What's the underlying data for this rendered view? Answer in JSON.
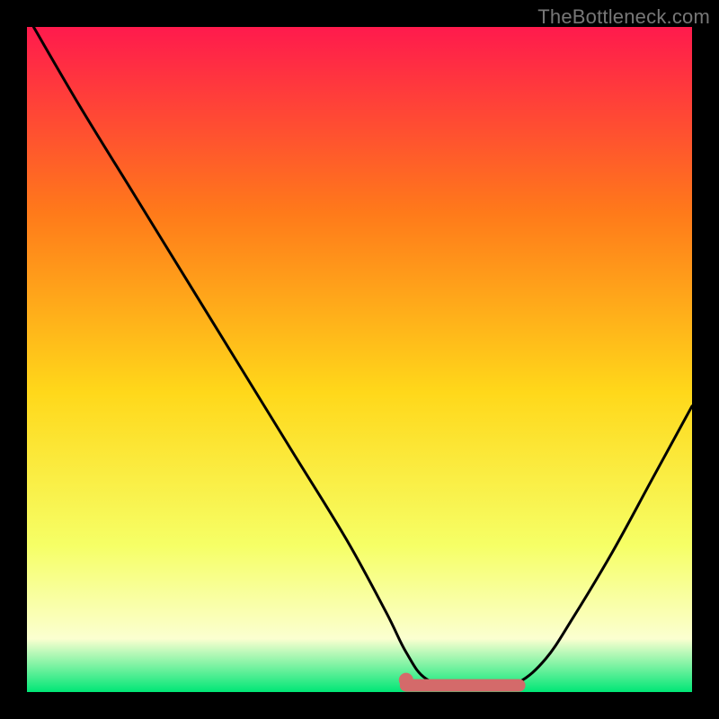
{
  "watermark": "TheBottleneck.com",
  "colors": {
    "background": "#000000",
    "grad_top": "#ff1a4d",
    "grad_upper_mid": "#ff7a1a",
    "grad_mid": "#ffd81a",
    "grad_lower_mid": "#f6ff66",
    "grad_pale": "#fbffd0",
    "grad_bottom": "#00e676",
    "curve": "#000000",
    "highlight": "#d46a6a"
  },
  "chart_data": {
    "type": "line",
    "title": "",
    "xlabel": "",
    "ylabel": "",
    "xlim": [
      0,
      100
    ],
    "ylim": [
      0,
      100
    ],
    "grid": false,
    "legend": false,
    "series": [
      {
        "name": "bottleneck-curve",
        "x": [
          1,
          8,
          16,
          24,
          32,
          40,
          48,
          54,
          57,
          60,
          65,
          70,
          74,
          78,
          82,
          88,
          94,
          100
        ],
        "y": [
          100,
          88,
          75,
          62,
          49,
          36,
          23,
          12,
          6,
          2,
          0.5,
          0.5,
          1.5,
          5,
          11,
          21,
          32,
          43
        ]
      }
    ],
    "highlight_segment": {
      "name": "optimal-range",
      "x_start": 57,
      "x_end": 74,
      "y": 1
    }
  }
}
